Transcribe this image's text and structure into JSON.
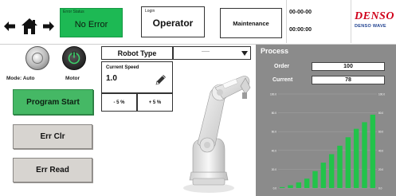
{
  "header": {
    "error_status": {
      "caption": "Error Status",
      "value": "No Error"
    },
    "login": {
      "caption": "Login",
      "value": "Operator"
    },
    "maintenance_label": "Maintenance",
    "date": "00-00-00",
    "time": "00:00:00",
    "logo": {
      "wordmark": "DENSO",
      "subtitle": "DENSO WAVE"
    },
    "icons": [
      "arrow-left-icon",
      "home-icon",
      "arrow-right-icon"
    ]
  },
  "controls": {
    "mode_label": "Mode: Auto",
    "motor_label": "Motor",
    "program_start_label": "Program Start",
    "err_clr_label": "Err Clr",
    "err_read_label": "Err Read"
  },
  "robot": {
    "type_label": "Robot Type",
    "type_selected": "-----",
    "current_speed_caption": "Current Speed",
    "current_speed_value": "1.0",
    "speed_down_label": "- 5 %",
    "speed_up_label": "+ 5 %"
  },
  "process": {
    "title": "Process",
    "order_label": "Order",
    "order_value": "100",
    "current_label": "Current",
    "current_value": "78"
  },
  "colors": {
    "status_ok": "#1db954",
    "start_button": "#45b865",
    "process_panel": "#8b8b8b",
    "bar": "#22c34a",
    "brand_red": "#d0001a"
  },
  "chart_data": {
    "type": "bar",
    "title": "",
    "xlabel": "",
    "ylabel": "",
    "ylim": [
      0,
      100
    ],
    "y_ticks": [
      "0.0",
      "20.0",
      "40.0",
      "60.0",
      "80.0",
      "100.0"
    ],
    "categories": [
      "1",
      "2",
      "3",
      "4",
      "5",
      "6",
      "7",
      "8",
      "9",
      "10",
      "11",
      "12"
    ],
    "values": [
      1,
      3,
      6,
      10,
      18,
      27,
      36,
      45,
      54,
      63,
      70,
      78
    ],
    "grid": true
  }
}
